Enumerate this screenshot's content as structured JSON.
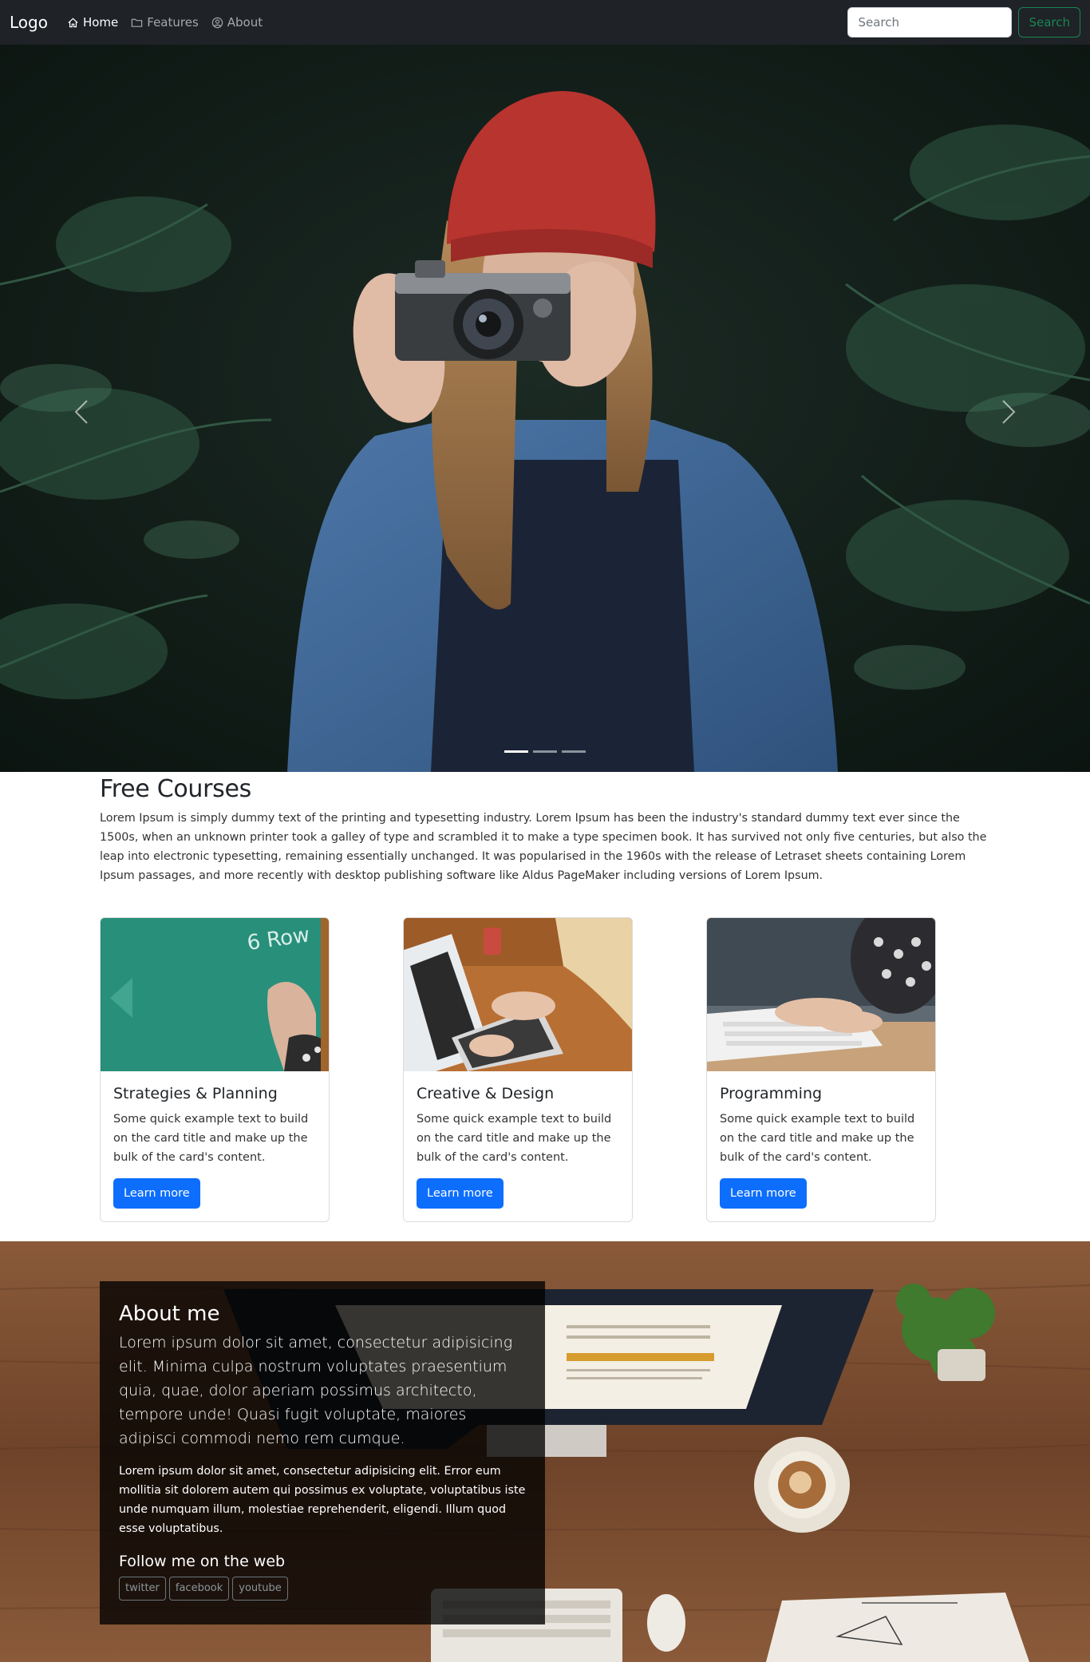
{
  "navbar": {
    "brand": "Logo",
    "links": [
      {
        "label": "Home",
        "icon": "home-icon",
        "active": true
      },
      {
        "label": "Features",
        "icon": "folder-icon",
        "active": false
      },
      {
        "label": "About",
        "icon": "user-circle-icon",
        "active": false
      }
    ],
    "search": {
      "placeholder": "Search",
      "button_label": "Search"
    }
  },
  "carousel": {
    "slide_count": 3,
    "active_slide": 1,
    "image_subject": "photographer-with-camera-in-forest"
  },
  "courses": {
    "title": "Free Courses",
    "description": "Lorem Ipsum is simply dummy text of the printing and typesetting industry. Lorem Ipsum has been the industry's standard dummy text ever since the 1500s, when an unknown printer took a galley of type and scrambled it to make a type specimen book. It has survived not only five centuries, but also the leap into electronic typesetting, remaining essentially unchanged. It was popularised in the 1960s with the release of Letraset sheets containing Lorem Ipsum passages, and more recently with desktop publishing software like Aldus PageMaker including versions of Lorem Ipsum.",
    "cards": [
      {
        "title": "Strategies & Planning",
        "text": "Some quick example text to build on the card title and make up the bulk of the card's content.",
        "button": "Learn more"
      },
      {
        "title": "Creative & Design",
        "text": "Some quick example text to build on the card title and make up the bulk of the card's content.",
        "button": "Learn more"
      },
      {
        "title": "Programming",
        "text": "Some quick example text to build on the card title and make up the bulk of the card's content.",
        "button": "Learn more"
      }
    ]
  },
  "about": {
    "title": "About me",
    "lead": "Lorem ipsum dolor sit amet, consectetur adipisicing elit. Minima culpa nostrum voluptates praesentium quia, quae, dolor aperiam possimus architecto, tempore unde! Quasi fugit voluptate, maiores adipisci commodi nemo rem cumque.",
    "text": "Lorem ipsum dolor sit amet, consectetur adipisicing elit. Error eum mollitia sit dolorem autem qui possimus ex voluptate, voluptatibus iste unde numquam illum, molestiae reprehenderit, eligendi. Illum quod esse voluptatibus.",
    "follow_title": "Follow me on the web",
    "social": [
      "twitter",
      "facebook",
      "youtube"
    ]
  },
  "colors": {
    "navbar_bg": "#1f2226",
    "primary": "#0d6efd",
    "success": "#198754"
  }
}
